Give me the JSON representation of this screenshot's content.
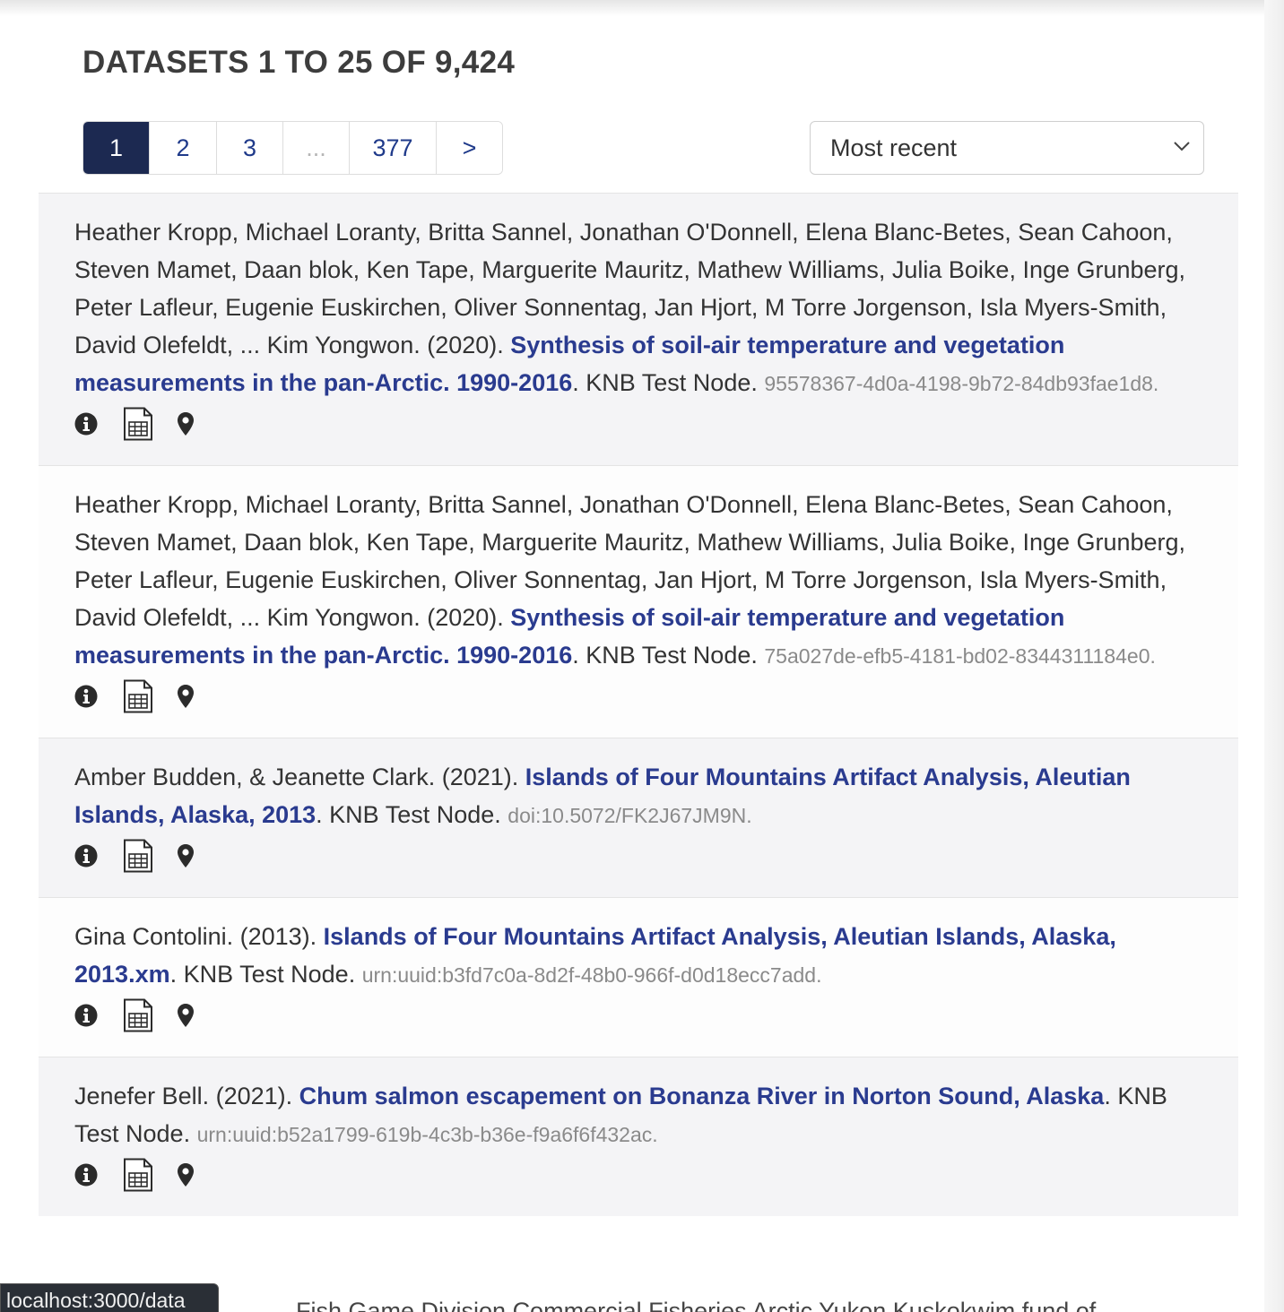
{
  "header": {
    "title": "DATASETS 1 TO 25 OF 9,424"
  },
  "pagination": {
    "pages": [
      "1",
      "2",
      "3",
      "...",
      "377",
      ">"
    ],
    "active": "1"
  },
  "sort": {
    "selected": "Most recent"
  },
  "results": [
    {
      "authors": "Heather Kropp, Michael Loranty, Britta Sannel, Jonathan O'Donnell, Elena Blanc-Betes, Sean Cahoon, Steven Mamet, Daan blok, Ken Tape, Marguerite Mauritz, Mathew Williams, Julia Boike, Inge Grunberg, Peter Lafleur, Eugenie Euskirchen, Oliver Sonnentag, Jan Hjort, M Torre Jorgenson, Isla Myers-Smith, David Olefeldt, ... Kim Yongwon. (2020). ",
      "title": "Synthesis of soil-air temperature and vegetation measurements in the pan-Arctic. 1990-2016",
      "node": ". KNB Test Node. ",
      "id": "95578367-4d0a-4198-9b72-84db93fae1d8."
    },
    {
      "authors": "Heather Kropp, Michael Loranty, Britta Sannel, Jonathan O'Donnell, Elena Blanc-Betes, Sean Cahoon, Steven Mamet, Daan blok, Ken Tape, Marguerite Mauritz, Mathew Williams, Julia Boike, Inge Grunberg, Peter Lafleur, Eugenie Euskirchen, Oliver Sonnentag, Jan Hjort, M Torre Jorgenson, Isla Myers-Smith, David Olefeldt, ... Kim Yongwon. (2020). ",
      "title": "Synthesis of soil-air temperature and vegetation measurements in the pan-Arctic. 1990-2016",
      "node": ". KNB Test Node. ",
      "id": "75a027de-efb5-4181-bd02-8344311184e0."
    },
    {
      "authors": "Amber Budden, & Jeanette Clark. (2021). ",
      "title": "Islands of Four Mountains Artifact Analysis, Aleutian Islands, Alaska, 2013",
      "node": ". KNB Test Node. ",
      "id": "doi:10.5072/FK2J67JM9N."
    },
    {
      "authors": "Gina Contolini. (2013). ",
      "title": "Islands of Four Mountains Artifact Analysis, Aleutian Islands, Alaska, 2013.xm",
      "node": ". KNB Test Node. ",
      "id": "urn:uuid:b3fd7c0a-8d2f-48b0-966f-d0d18ecc7add."
    },
    {
      "authors": "Jenefer Bell. (2021). ",
      "title": "Chum salmon escapement on Bonanza River in Norton Sound, Alaska",
      "node": ". KNB Test Node. ",
      "id": "urn:uuid:b52a1799-619b-4c3b-b36e-f9a6f6f432ac."
    }
  ],
  "icons": [
    "info-icon",
    "data-table-icon",
    "map-marker-icon"
  ],
  "colors": {
    "title_link": "#2a3b8f",
    "active_page": "#1c2951",
    "shaded_row": "#f4f4f6"
  },
  "statusbar": {
    "url": "localhost:3000/data"
  },
  "partial_row": {
    "text": "Fish Game Division Commercial Fisheries Arctic Yukon Kuskokwim fund of"
  }
}
